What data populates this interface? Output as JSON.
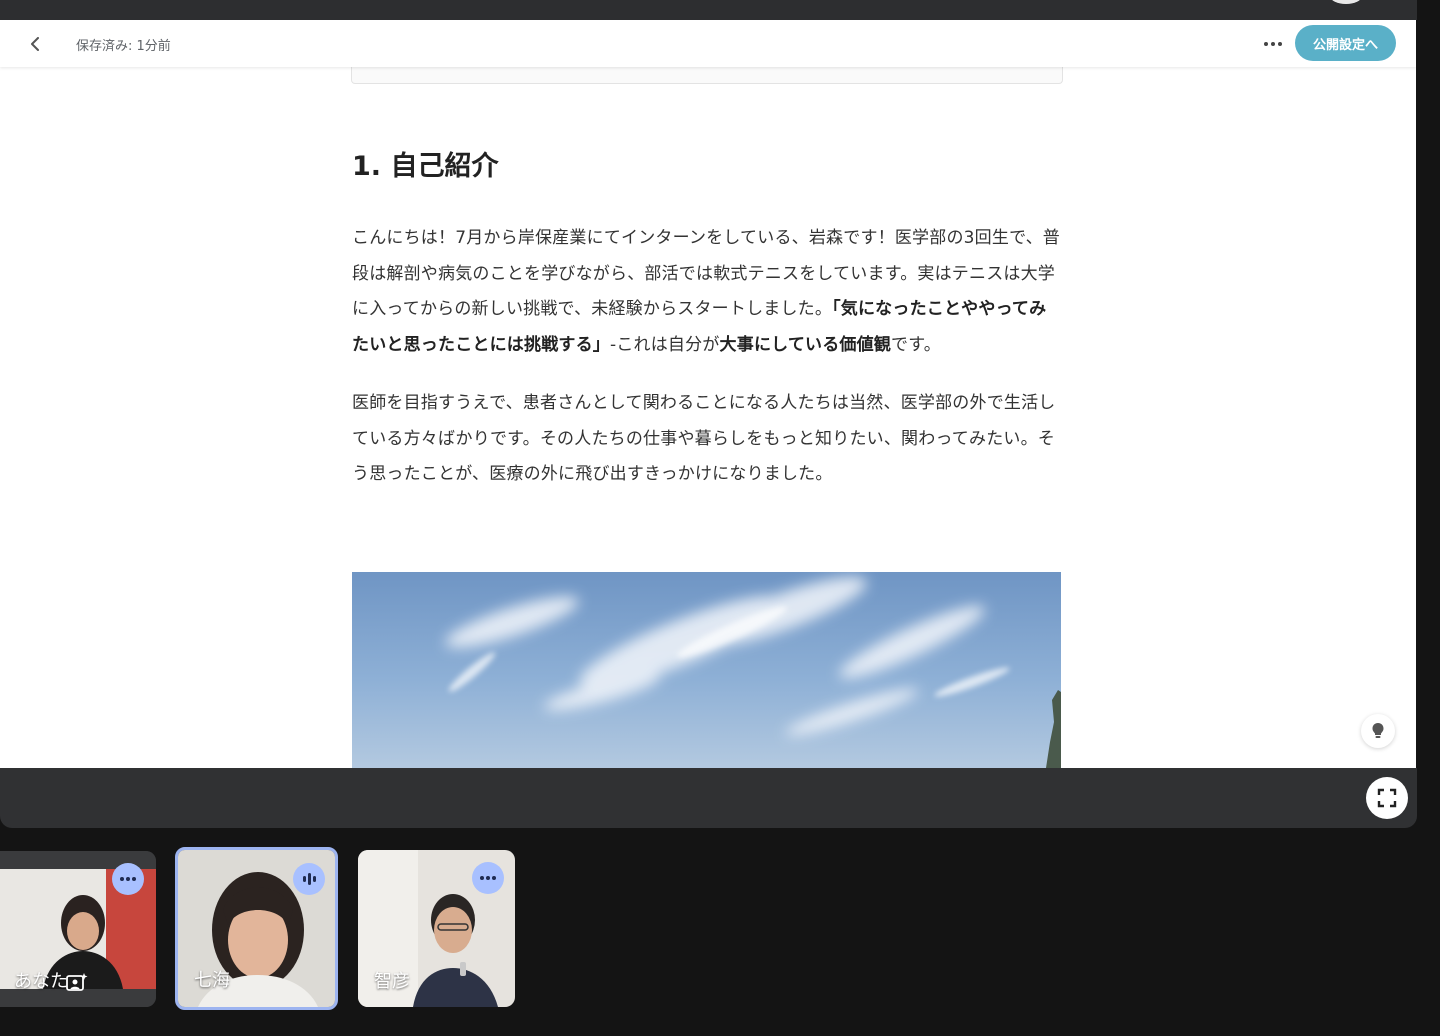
{
  "editor": {
    "save_status": "保存済み: 1分前",
    "publish_label": "公開設定へ"
  },
  "article": {
    "heading": "1.  自己紹介",
    "para1": [
      {
        "t": "こんにちは！7月から岸保産業にてインターンをしている、岩森です！医学部の3回生で、普段は解剖や病気のことを学びながら、部活では軟式テニスをしています。実はテニスは大学に入ってからの新しい挑戦で、未経験からスタートしました。",
        "b": false
      },
      {
        "t": "「気になったことややってみたいと思ったことには挑戦する」",
        "b": true
      },
      {
        "t": "-これは自分が",
        "b": false
      },
      {
        "t": "大事にしている価値観",
        "b": true
      },
      {
        "t": "です。",
        "b": false
      }
    ],
    "para2": "医師を目指すうえで、患者さんとして関わることになる人たちは当然、医学部の外で生活している方々ばかりです。その人たちの仕事や暮らしをもっと知りたい、関わってみたい。そう思ったことが、医療の外に飛び出すきっかけになりました。"
  },
  "participants": [
    {
      "name": "あなた"
    },
    {
      "name": "七海"
    },
    {
      "name": "智彦"
    }
  ],
  "colors": {
    "publish": "#5ab0c8",
    "active_speaker_border": "#9db4f0",
    "tile_menu": "#a8c0ff"
  },
  "icons": [
    "back-chevron-icon",
    "more-dots-icon",
    "lightbulb-icon",
    "fullscreen-icon",
    "speaking-bars-icon",
    "visual-effects-icon"
  ]
}
